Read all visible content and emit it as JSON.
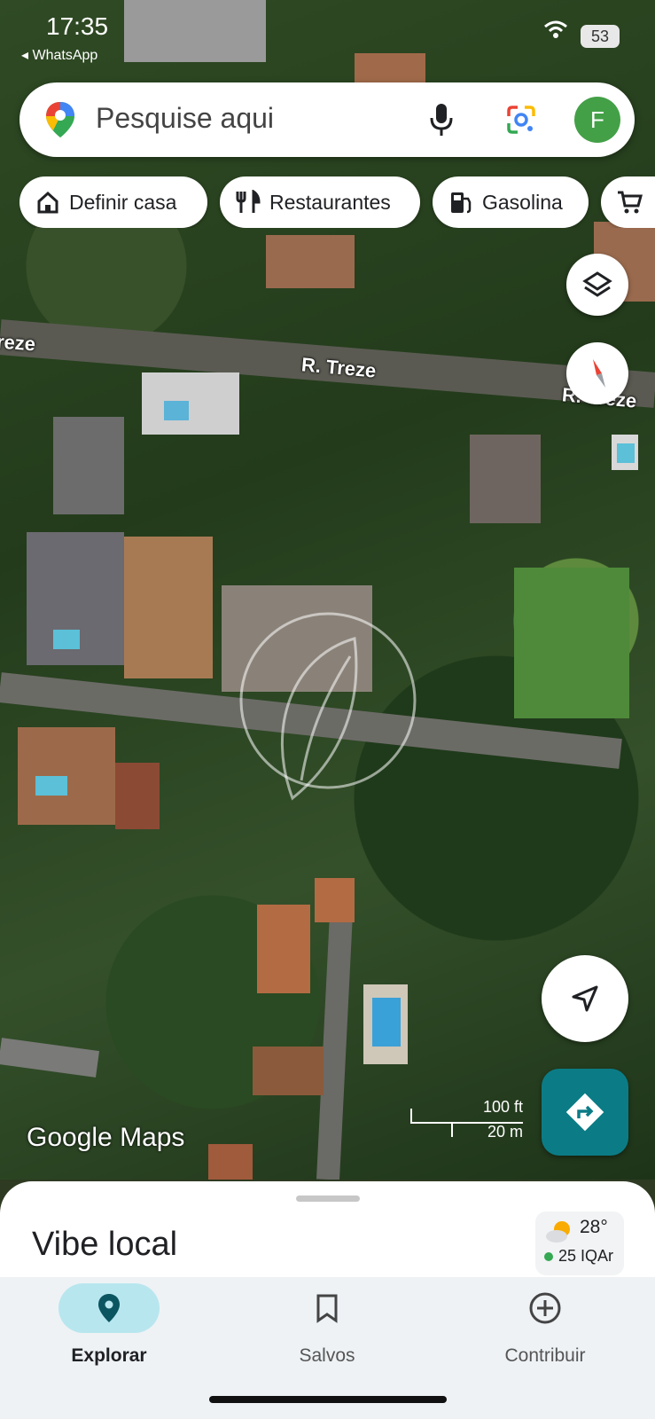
{
  "status_bar": {
    "time": "17:35",
    "back_app": "◂ WhatsApp",
    "battery": "53"
  },
  "search": {
    "placeholder": "Pesquise aqui",
    "avatar_letter": "F"
  },
  "chips": [
    {
      "label": "Definir casa",
      "icon": "home-icon"
    },
    {
      "label": "Restaurantes",
      "icon": "restaurant-icon"
    },
    {
      "label": "Gasolina",
      "icon": "gas-station-icon"
    },
    {
      "label": "",
      "icon": "shopping-cart-icon"
    }
  ],
  "map": {
    "streets": [
      "R. Treze",
      "reze",
      "R. Treze"
    ],
    "scale_ft": "100 ft",
    "scale_m": "20 m",
    "logo": "Google Maps",
    "watermark": "leaf-logo"
  },
  "sheet": {
    "title": "Vibe local",
    "weather_temp": "28°",
    "air_quality": "25 IQAr"
  },
  "bottom_nav": [
    {
      "label": "Explorar",
      "icon": "location-pin-icon",
      "active": true
    },
    {
      "label": "Salvos",
      "icon": "bookmark-icon",
      "active": false
    },
    {
      "label": "Contribuir",
      "icon": "add-circle-icon",
      "active": false
    }
  ],
  "colors": {
    "accent": "#0b7c86",
    "nav_active": "#b8e6ee",
    "avatar": "#43a047"
  }
}
